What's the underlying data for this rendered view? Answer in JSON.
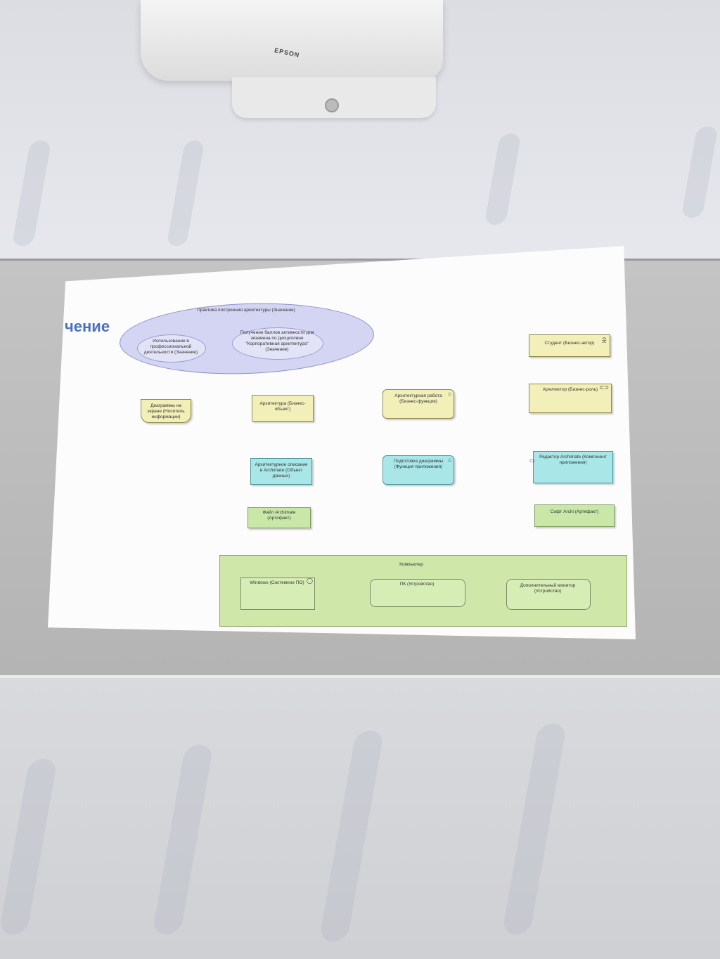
{
  "projector": {
    "brand": "EPSON"
  },
  "slide": {
    "heading": "чение",
    "value_group": {
      "title": "Практика построения архитектуры (Значение)",
      "value_1": "Использование в профессиональной деятельности (Значение)",
      "value_2": "Получение баллов активности для экзамена по дисциплине \"Корпоративная архитектура\" (Значение)"
    },
    "elements": {
      "diagrams_on_screen": "Диаграммы на экране (Носитель информации)",
      "architecture_object": "Архитектура (Бизнес-объект)",
      "architecture_work": "Архитектурная работа (Бизнес-функция)",
      "student_actor": "Студент (Бизнес-актор)",
      "architect_role": "Архитектор (Бизнес-роль)",
      "archimate_description": "Архитектурное описание в Archimate (Объект данных)",
      "diagram_preparation": "Подготовка диаграммы (Функция приложения)",
      "archimate_editor": "Редактор Archimate (Компонент приложения)",
      "archimate_file": "Файл Archimate (Артефакт)",
      "archi_software": "Софт Archi (Артефакт)"
    },
    "computer_node": {
      "title": "Компьютер",
      "windows": "Windows (Системное ПО)",
      "pc": "ПК (Устройство)",
      "monitor": "Дополнительный монитор (Устройство)"
    }
  }
}
